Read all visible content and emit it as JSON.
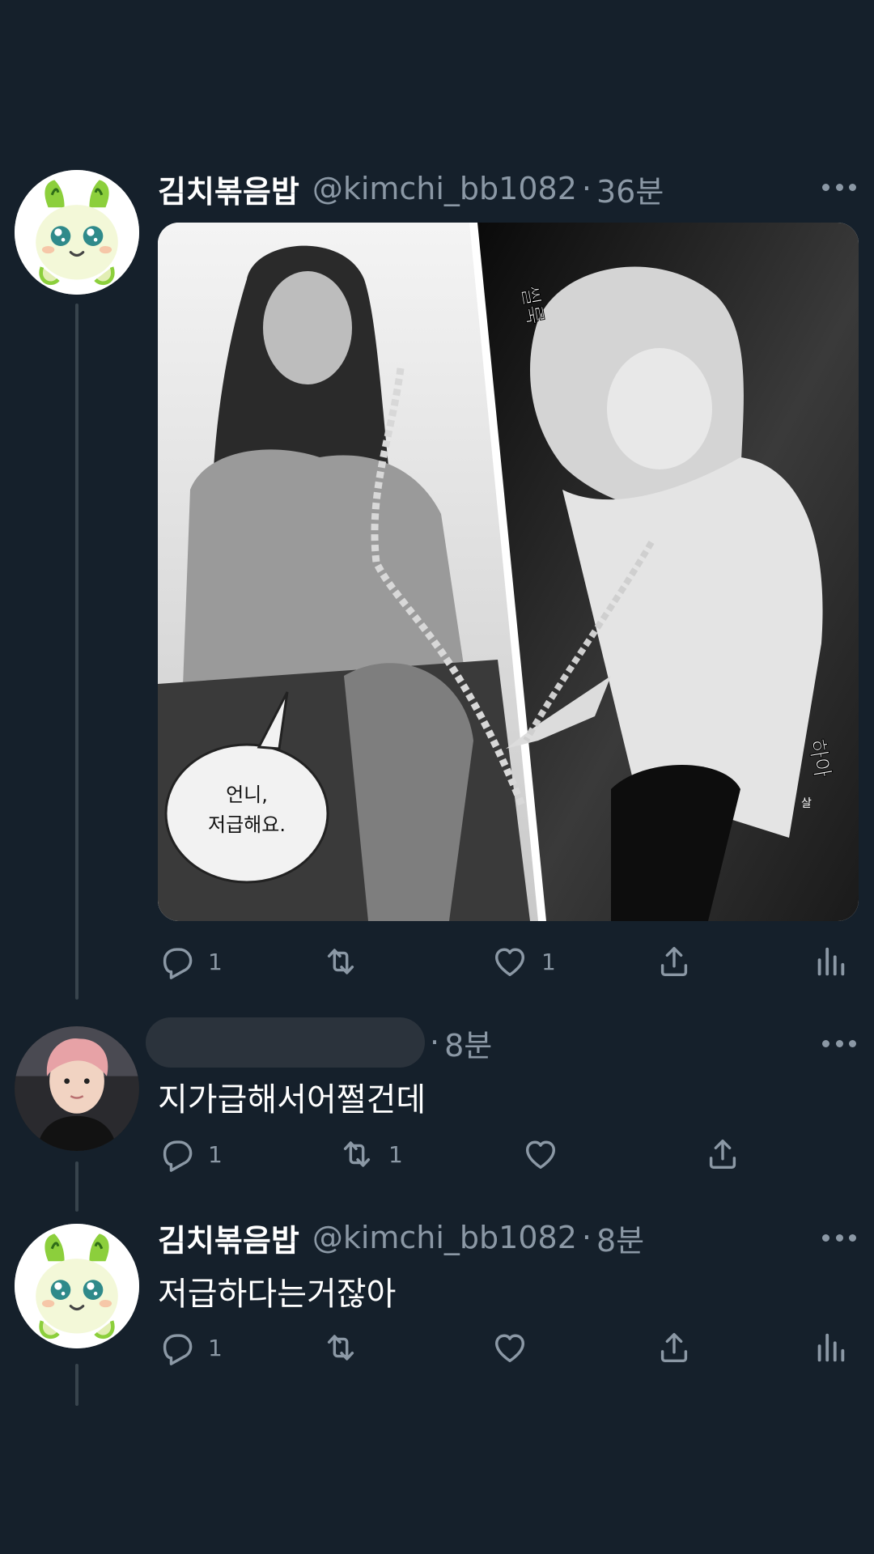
{
  "tweets": [
    {
      "name": "김치볶음밥",
      "handle": "@kimchi_bb1082",
      "separator": "·",
      "time": "36분",
      "avatar_icon": "green-character-avatar",
      "media": {
        "speech_bubble_line1": "언니,",
        "speech_bubble_line2": "저급해요.",
        "sfx_left": "씰룩",
        "sfx_right": "하아",
        "sfx_small": "살"
      },
      "actions": {
        "reply_count": "1",
        "retweet_count": "",
        "like_count": "1"
      }
    },
    {
      "name": "",
      "handle": "",
      "separator": "·",
      "time": "8분",
      "avatar_icon": "person-photo-avatar",
      "text": "지가급해서어쩔건데",
      "actions": {
        "reply_count": "1",
        "retweet_count": "1",
        "like_count": ""
      }
    },
    {
      "name": "김치볶음밥",
      "handle": "@kimchi_bb1082",
      "separator": "·",
      "time": "8분",
      "avatar_icon": "green-character-avatar",
      "text": "저급하다는거잖아",
      "actions": {
        "reply_count": "1",
        "retweet_count": "",
        "like_count": ""
      }
    }
  ],
  "colors": {
    "background": "#15202b",
    "secondary_text": "#8b98a5",
    "thread_line": "#38444d",
    "avatar_green": "#8ccf3c"
  }
}
